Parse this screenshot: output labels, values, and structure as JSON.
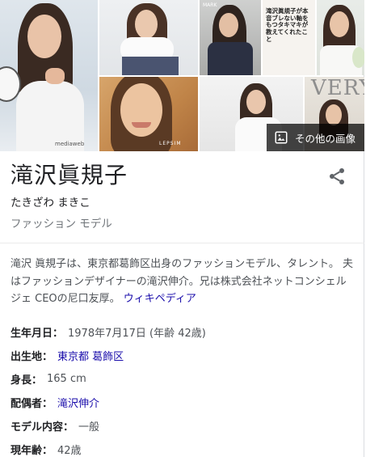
{
  "panel": {
    "more_images_label": "その他の画像",
    "title": "滝沢眞規子",
    "reading": "たきざわ まきこ",
    "subtitle": "ファッション モデル",
    "share_icon": "share-icon"
  },
  "gallery": {
    "tile_main_caption": "mediaweb",
    "tile_b_caption": "MARK",
    "tile_c_text": "滝沢眞規子が本音ブレない軸をもつタキマキが教えてくれたこと",
    "tile_e_caption": "LEPSIM",
    "tile_g_caption": "VERY"
  },
  "description": {
    "text": "滝沢 眞規子は、東京都葛飾区出身のファッションモデル、タレント。 夫はファッションデザイナーの滝沢伸介。兄は株式会社ネットコンシェルジェ CEOの尼口友厚。",
    "link": "ウィキペディア"
  },
  "facts": [
    {
      "key": "生年月日：",
      "value": "1978年7月17日 (年齢 42歳)"
    },
    {
      "key": "出生地：",
      "link1": "東京都",
      "link2": "葛飾区"
    },
    {
      "key": "身長：",
      "value": "165 cm"
    },
    {
      "key": "配偶者：",
      "link1": "滝沢伸介"
    },
    {
      "key": "モデル内容：",
      "value": "一般"
    },
    {
      "key": "現年齢：",
      "value": "42歳"
    }
  ]
}
